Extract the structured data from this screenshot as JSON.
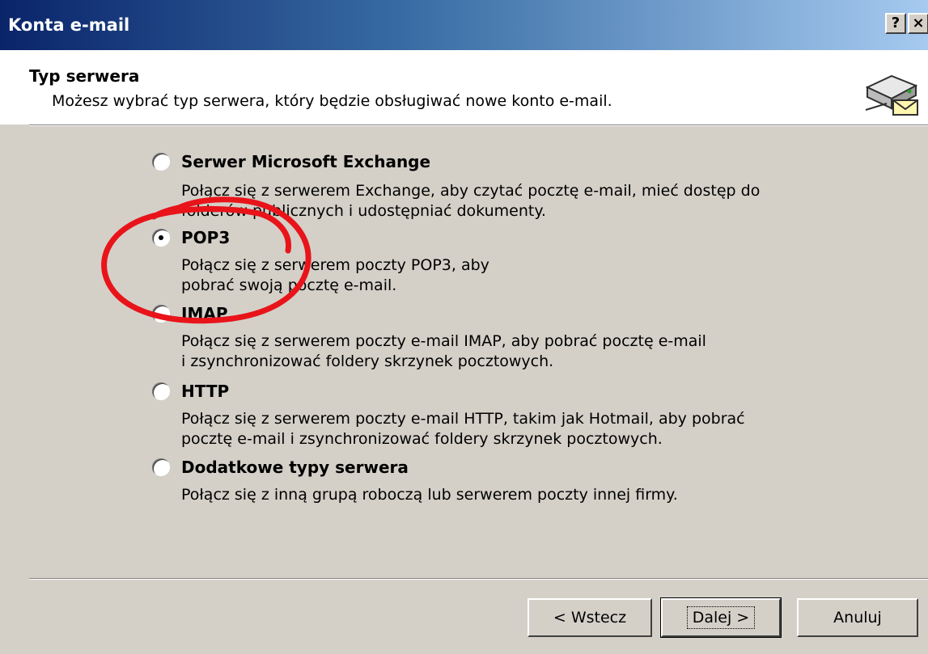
{
  "window": {
    "title": "Konta e-mail",
    "help_label": "?",
    "close_label": "×"
  },
  "header": {
    "title": "Typ serwera",
    "description": "Możesz wybrać typ serwera, który będzie obsługiwać nowe konto e-mail.",
    "icon": "server-mail-icon"
  },
  "options": [
    {
      "label": "Serwer Microsoft Exchange",
      "selected": false,
      "description_lines": [
        "Połącz się z serwerem Exchange, aby czytać pocztę e-mail, mieć dostęp do",
        "folderów publicznych i udostępniać dokumenty."
      ]
    },
    {
      "label": "POP3",
      "selected": true,
      "description_lines": [
        "Połącz się z serwerem poczty POP3, aby",
        "pobrać swoją pocztę e-mail."
      ]
    },
    {
      "label": "IMAP",
      "selected": false,
      "description_lines": [
        "Połącz się z serwerem poczty e-mail IMAP, aby pobrać pocztę e-mail",
        "i zsynchronizować foldery skrzynek pocztowych."
      ]
    },
    {
      "label": "HTTP",
      "selected": false,
      "description_lines": [
        "Połącz się z serwerem poczty e-mail HTTP, takim jak Hotmail, aby pobrać",
        "pocztę e-mail i zsynchronizować foldery skrzynek pocztowych."
      ]
    },
    {
      "label": "Dodatkowe typy serwera",
      "selected": false,
      "description_lines": [
        "Połącz się z inną grupą roboczą lub serwerem poczty innej firmy."
      ]
    }
  ],
  "buttons": {
    "back": "< Wstecz",
    "next": "Dalej >",
    "cancel": "Anuluj"
  },
  "annotation": {
    "color": "#e8141a",
    "shape": "hand-drawn circle around POP3 option"
  }
}
